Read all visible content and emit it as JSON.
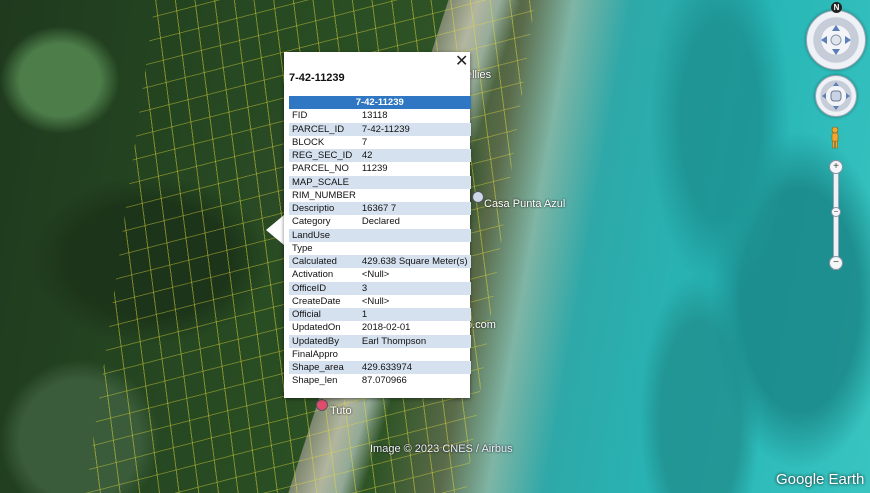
{
  "map": {
    "labels": {
      "ellies": "ellies",
      "casa_punta_azul": "Casa Punta Azul",
      "p_com": "p.com",
      "tuto": "Tuto"
    },
    "attribution": "Image © 2023 CNES / Airbus",
    "brand": "Google Earth"
  },
  "nav": {
    "north_label": "N",
    "zoom_in": "+",
    "zoom_mid": "−",
    "zoom_out": "−"
  },
  "popup": {
    "close_glyph": "✕",
    "title": "7-42-11239",
    "header_value": "7-42-11239",
    "rows": [
      {
        "key": "FID",
        "value": "13118"
      },
      {
        "key": "PARCEL_ID",
        "value": "7-42-11239"
      },
      {
        "key": "BLOCK",
        "value": "7"
      },
      {
        "key": "REG_SEC_ID",
        "value": "42"
      },
      {
        "key": "PARCEL_NO",
        "value": "11239"
      },
      {
        "key": "MAP_SCALE",
        "value": ""
      },
      {
        "key": "RIM_NUMBER",
        "value": ""
      },
      {
        "key": "Descriptio",
        "value": "16367 7"
      },
      {
        "key": "Category",
        "value": "Declared"
      },
      {
        "key": "LandUse",
        "value": ""
      },
      {
        "key": "Type",
        "value": ""
      },
      {
        "key": "Calculated",
        "value": "429.638 Square Meter(s)"
      },
      {
        "key": "Activation",
        "value": "<Null>"
      },
      {
        "key": "OfficeID",
        "value": "3"
      },
      {
        "key": "CreateDate",
        "value": "<Null>"
      },
      {
        "key": "Official",
        "value": "1"
      },
      {
        "key": "UpdatedOn",
        "value": "2018-02-01"
      },
      {
        "key": "UpdatedBy",
        "value": "Earl Thompson"
      },
      {
        "key": "FinalAppro",
        "value": ""
      },
      {
        "key": "Shape_area",
        "value": "429.633974"
      },
      {
        "key": "Shape_len",
        "value": "87.070966"
      }
    ]
  }
}
